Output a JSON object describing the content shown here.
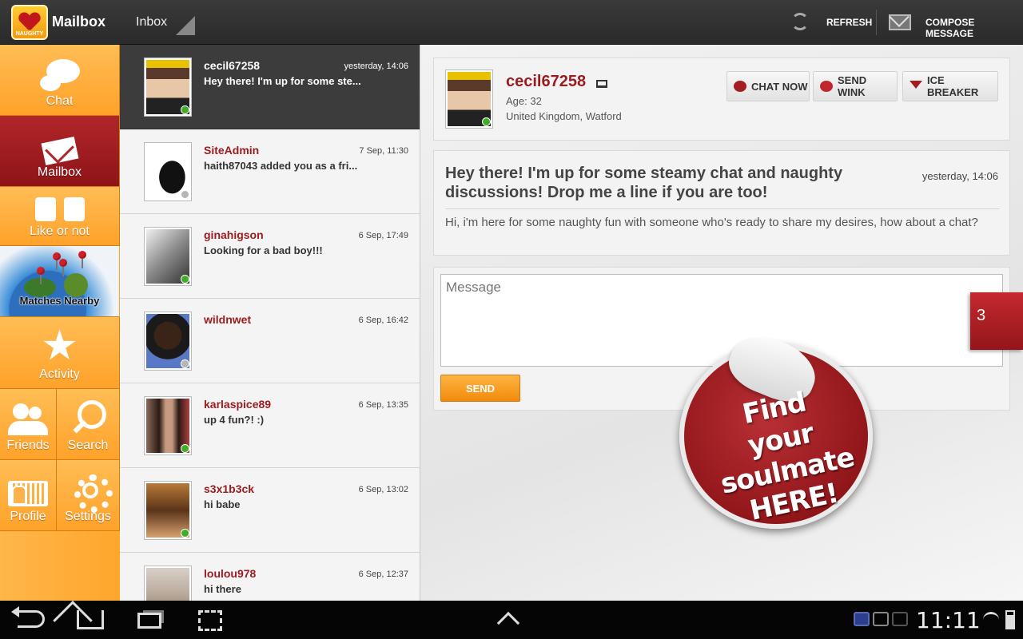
{
  "topbar": {
    "title": "Mailbox",
    "folder": "Inbox",
    "refresh_label": "REFRESH",
    "compose_label": "COMPOSE MESSAGE",
    "logo_text": "NAUGHTY"
  },
  "nav": {
    "chat": "Chat",
    "mailbox": "Mailbox",
    "like": "Like or not",
    "nearby": "Matches Nearby",
    "activity": "Activity",
    "friends": "Friends",
    "search": "Search",
    "profile": "Profile",
    "settings": "Settings",
    "active_item": "Mailbox"
  },
  "conversations": [
    {
      "name": "cecil67258",
      "time": "yesterday, 14:06",
      "preview": "Hey there! I'm up for some ste...",
      "online": true,
      "selected": true
    },
    {
      "name": "SiteAdmin",
      "time": "7 Sep, 11:30",
      "preview": "haith87043 added you as a fri...",
      "online": false,
      "selected": false
    },
    {
      "name": "ginahigson",
      "time": "6 Sep, 17:49",
      "preview": "Looking for a bad boy!!!",
      "online": true,
      "selected": false
    },
    {
      "name": "wildnwet",
      "time": "6 Sep, 16:42",
      "preview": "",
      "online": false,
      "selected": false
    },
    {
      "name": "karlaspice89",
      "time": "6 Sep, 13:35",
      "preview": "up 4 fun?! :)",
      "online": true,
      "selected": false
    },
    {
      "name": "s3x1b3ck",
      "time": "6 Sep, 13:02",
      "preview": "hi babe",
      "online": true,
      "selected": false
    },
    {
      "name": "loulou978",
      "time": "6 Sep, 12:37",
      "preview": "hi there",
      "online": false,
      "selected": false
    }
  ],
  "profile": {
    "name": "cecil67258",
    "age": "Age: 32",
    "location": "United Kingdom, Watford",
    "online": true
  },
  "actions": {
    "chat_now": "CHAT NOW",
    "send_wink": "SEND WINK",
    "ice_breaker": "ICE BREAKER"
  },
  "message": {
    "subject": "Hey there! I'm up for some steamy chat and naughty discussions! Drop me a line if you are too!",
    "time": "yesterday, 14:06",
    "body": "Hi, i'm here for some naughty fun with someone who's ready to share my desires, how about a chat?"
  },
  "reply": {
    "placeholder": "Message",
    "value": "",
    "send_label": "SEND"
  },
  "badge": {
    "count": "3"
  },
  "promo": {
    "line1": "Find",
    "line2": "your soulmate",
    "line3": "HERE!"
  },
  "system": {
    "clock": "11:11"
  },
  "colors": {
    "brand_red": "#9b1b1e",
    "nav_orange": "#ffa62c",
    "send_orange": "#f28a0c",
    "online_green": "#3fae26"
  }
}
